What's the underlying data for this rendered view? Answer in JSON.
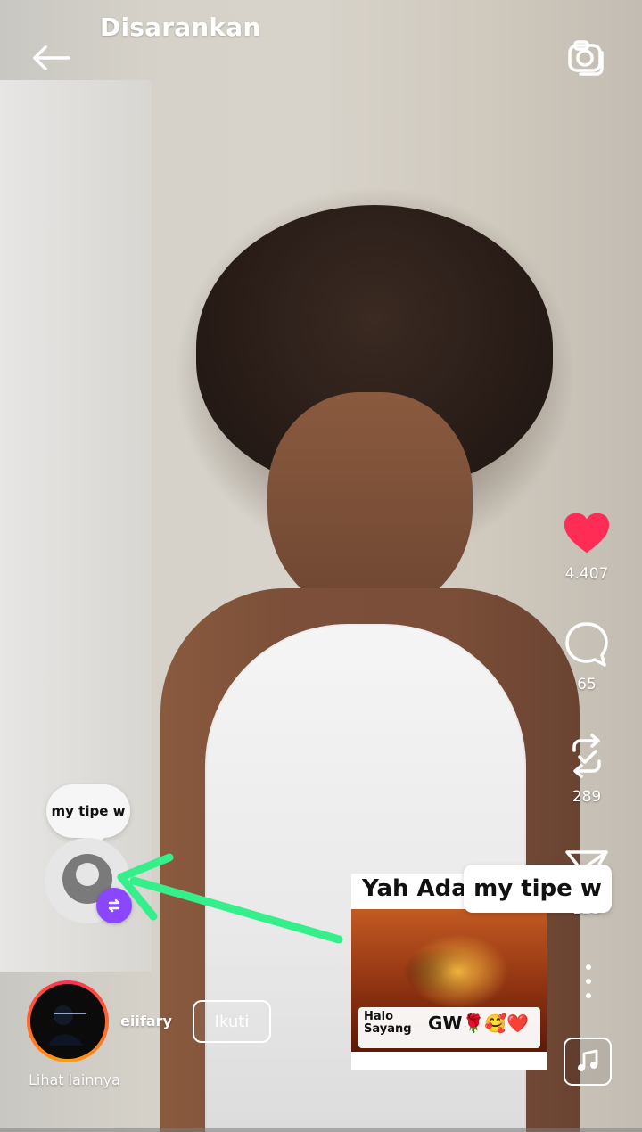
{
  "header": {
    "title": "Disarankan"
  },
  "icons": {
    "back": "back-arrow-icon",
    "camera": "camera-icon",
    "like": "heart-icon",
    "comment": "comment-icon",
    "repost": "repost-icon",
    "share": "send-icon",
    "more": "more-icon",
    "music": "music-icon"
  },
  "engagement": {
    "likes": "4.407",
    "comments": "65",
    "reposts": "289",
    "shares": "125"
  },
  "overlay": {
    "bubble_text": "my tipe w",
    "sticker_title": "Yah Ada",
    "sticker_caption_left": "Halo\nSayang",
    "sticker_caption_right": "GW🌹🥰❤️",
    "tag_text_right": "my tipe w"
  },
  "user": {
    "handle": "eiifary",
    "follow_label": "Ikuti",
    "see_more": "Lihat lainnya"
  },
  "colors": {
    "heart": "#ff2d55",
    "repost_badge": "#8b47ff",
    "arrow": "#35f08a"
  }
}
